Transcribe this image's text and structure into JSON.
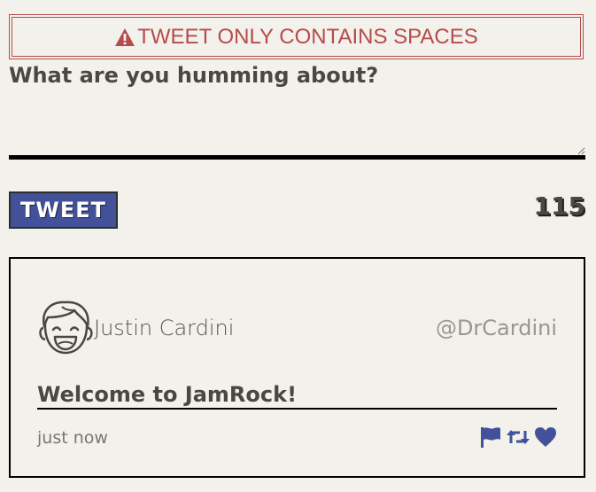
{
  "error": {
    "message": "TWEET ONLY CONTAINS SPACES",
    "icon": "warning-triangle-icon",
    "color": "#b64b4b"
  },
  "compose": {
    "prompt": "What are you humming about?",
    "value": "",
    "tweet_button_label": "TWEET",
    "char_counter": "115",
    "button_color": "#43519a"
  },
  "tweet": {
    "author_name": "Justin Cardini",
    "author_handle": "@DrCardini",
    "text": "Welcome to JamRock!",
    "timestamp": "just now",
    "actions": [
      "flag-icon",
      "retweet-icon",
      "heart-icon"
    ],
    "icon_color": "#43519a"
  }
}
